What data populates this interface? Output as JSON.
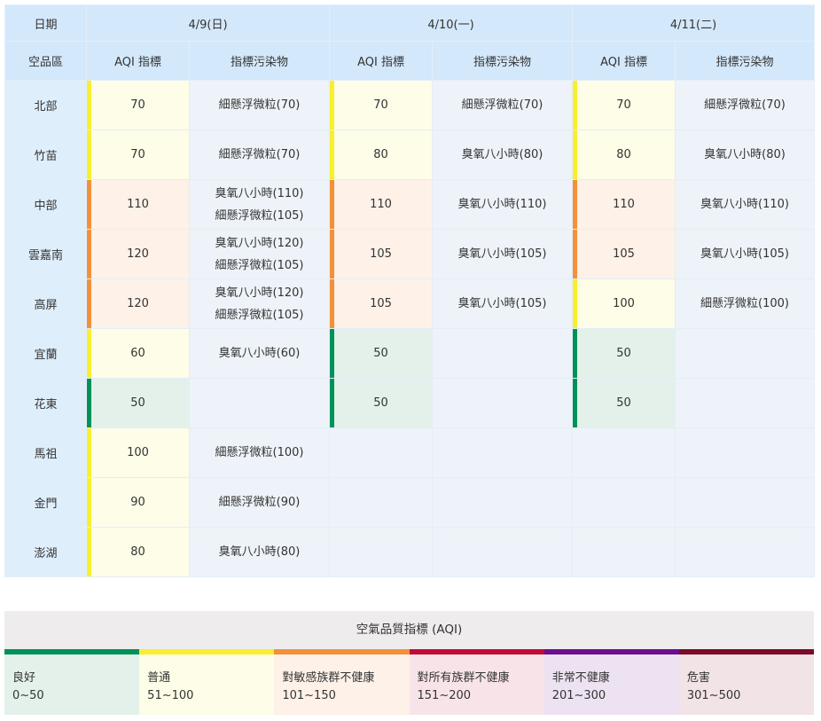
{
  "header": {
    "date_label": "日期",
    "area_label": "空品區",
    "aqi_label": "AQI 指標",
    "pollutant_label": "指標污染物",
    "dates": [
      "4/9(日)",
      "4/10(一)",
      "4/11(二)"
    ]
  },
  "rows": [
    {
      "area": "北部",
      "days": [
        {
          "aqi": "70",
          "level": "moderate",
          "pollutants": [
            "細懸浮微粒(70)"
          ]
        },
        {
          "aqi": "70",
          "level": "moderate",
          "pollutants": [
            "細懸浮微粒(70)"
          ]
        },
        {
          "aqi": "70",
          "level": "moderate",
          "pollutants": [
            "細懸浮微粒(70)"
          ]
        }
      ]
    },
    {
      "area": "竹苗",
      "days": [
        {
          "aqi": "70",
          "level": "moderate",
          "pollutants": [
            "細懸浮微粒(70)"
          ]
        },
        {
          "aqi": "80",
          "level": "moderate",
          "pollutants": [
            "臭氧八小時(80)"
          ]
        },
        {
          "aqi": "80",
          "level": "moderate",
          "pollutants": [
            "臭氧八小時(80)"
          ]
        }
      ]
    },
    {
      "area": "中部",
      "days": [
        {
          "aqi": "110",
          "level": "usg",
          "pollutants": [
            "臭氧八小時(110)",
            "細懸浮微粒(105)"
          ]
        },
        {
          "aqi": "110",
          "level": "usg",
          "pollutants": [
            "臭氧八小時(110)"
          ]
        },
        {
          "aqi": "110",
          "level": "usg",
          "pollutants": [
            "臭氧八小時(110)"
          ]
        }
      ]
    },
    {
      "area": "雲嘉南",
      "days": [
        {
          "aqi": "120",
          "level": "usg",
          "pollutants": [
            "臭氧八小時(120)",
            "細懸浮微粒(105)"
          ]
        },
        {
          "aqi": "105",
          "level": "usg",
          "pollutants": [
            "臭氧八小時(105)"
          ]
        },
        {
          "aqi": "105",
          "level": "usg",
          "pollutants": [
            "臭氧八小時(105)"
          ]
        }
      ]
    },
    {
      "area": "高屏",
      "days": [
        {
          "aqi": "120",
          "level": "usg",
          "pollutants": [
            "臭氧八小時(120)",
            "細懸浮微粒(105)"
          ]
        },
        {
          "aqi": "105",
          "level": "usg",
          "pollutants": [
            "臭氧八小時(105)"
          ]
        },
        {
          "aqi": "100",
          "level": "moderate",
          "pollutants": [
            "細懸浮微粒(100)"
          ]
        }
      ]
    },
    {
      "area": "宜蘭",
      "days": [
        {
          "aqi": "60",
          "level": "moderate",
          "pollutants": [
            "臭氧八小時(60)"
          ]
        },
        {
          "aqi": "50",
          "level": "good",
          "pollutants": []
        },
        {
          "aqi": "50",
          "level": "good",
          "pollutants": []
        }
      ]
    },
    {
      "area": "花東",
      "days": [
        {
          "aqi": "50",
          "level": "good",
          "pollutants": []
        },
        {
          "aqi": "50",
          "level": "good",
          "pollutants": []
        },
        {
          "aqi": "50",
          "level": "good",
          "pollutants": []
        }
      ]
    },
    {
      "area": "馬祖",
      "days": [
        {
          "aqi": "100",
          "level": "moderate",
          "pollutants": [
            "細懸浮微粒(100)"
          ]
        },
        null,
        null
      ]
    },
    {
      "area": "金門",
      "days": [
        {
          "aqi": "90",
          "level": "moderate",
          "pollutants": [
            "細懸浮微粒(90)"
          ]
        },
        null,
        null
      ]
    },
    {
      "area": "澎湖",
      "days": [
        {
          "aqi": "80",
          "level": "moderate",
          "pollutants": [
            "臭氧八小時(80)"
          ]
        },
        null,
        null
      ]
    }
  ],
  "legend": {
    "title": "空氣品質指標 (AQI)",
    "items": [
      {
        "name": "良好",
        "range": "0~50",
        "color": "#00915a",
        "bg": "#e3f1ea"
      },
      {
        "name": "普通",
        "range": "51~100",
        "color": "#f7ef2f",
        "bg": "#fdfde8"
      },
      {
        "name": "對敏感族群不健康",
        "range": "101~150",
        "color": "#f3913a",
        "bg": "#fdf1e8"
      },
      {
        "name": "對所有族群不健康",
        "range": "151~200",
        "color": "#c00d36",
        "bg": "#f8e4e8"
      },
      {
        "name": "非常不健康",
        "range": "201~300",
        "color": "#6b0f8e",
        "bg": "#ede2f1"
      },
      {
        "name": "危害",
        "range": "301~500",
        "color": "#7b0b27",
        "bg": "#f1e3e6"
      }
    ]
  }
}
